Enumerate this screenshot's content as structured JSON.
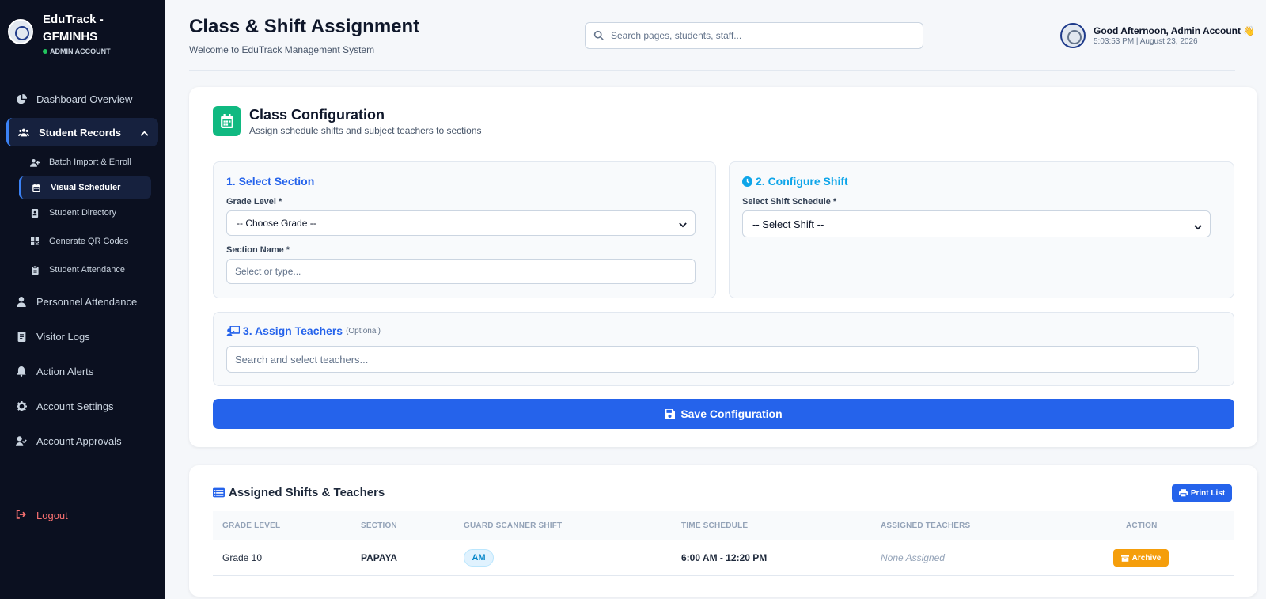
{
  "sidebar": {
    "brand_name": "EduTrack - GFMINHS",
    "role": "ADMIN ACCOUNT",
    "items": [
      {
        "label": "Dashboard Overview",
        "icon": "chart-pie-icon"
      },
      {
        "label": "Student Records",
        "icon": "users-icon"
      },
      {
        "label": "Personnel Attendance",
        "icon": "user-icon"
      },
      {
        "label": "Visitor Logs",
        "icon": "book-icon"
      },
      {
        "label": "Action Alerts",
        "icon": "bell-icon"
      },
      {
        "label": "Account Settings",
        "icon": "gear-icon"
      },
      {
        "label": "Account Approvals",
        "icon": "user-check-icon"
      }
    ],
    "sub_items": [
      {
        "label": "Batch Import & Enroll",
        "icon": "user-plus-icon"
      },
      {
        "label": "Visual Scheduler",
        "icon": "calendar-icon"
      },
      {
        "label": "Student Directory",
        "icon": "address-book-icon"
      },
      {
        "label": "Generate QR Codes",
        "icon": "qrcode-icon"
      },
      {
        "label": "Student Attendance",
        "icon": "clipboard-icon"
      }
    ],
    "logout": "Logout"
  },
  "header": {
    "title": "Class & Shift Assignment",
    "subtitle": "Welcome to EduTrack Management System",
    "search_placeholder": "Search pages, students, staff...",
    "greeting": "Good Afternoon, Admin Account 👋",
    "clock": "5:03:53 PM | August 23, 2026"
  },
  "config": {
    "title": "Class Configuration",
    "subtitle": "Assign schedule shifts and subject teachers to sections",
    "section_panel": {
      "title": "1. Select Section",
      "grade_label": "Grade Level *",
      "grade_value": "-- Choose Grade --",
      "section_label": "Section Name *",
      "section_placeholder": "Select or type..."
    },
    "shift_panel": {
      "title": "2. Configure Shift",
      "shift_label": "Select Shift Schedule *",
      "shift_value": "-- Select Shift --"
    },
    "teacher_panel": {
      "title": "3. Assign Teachers",
      "optional": "(Optional)",
      "placeholder": "Search and select teachers..."
    },
    "save_label": "Save Configuration"
  },
  "assigned": {
    "title": "Assigned Shifts & Teachers",
    "print_label": "Print List",
    "columns": [
      "GRADE LEVEL",
      "SECTION",
      "GUARD SCANNER SHIFT",
      "TIME SCHEDULE",
      "ASSIGNED TEACHERS",
      "ACTION"
    ],
    "rows": [
      {
        "grade": "Grade 10",
        "section": "PAPAYA",
        "shift": "AM",
        "time": "6:00 AM - 12:20 PM",
        "teachers": "None Assigned",
        "action": "Archive"
      }
    ]
  },
  "colors": {
    "sidebar_bg": "#0b1020",
    "accent": "#2563eb",
    "config_icon": "#10b981",
    "archive": "#f59e0b",
    "logout": "#f87171"
  }
}
